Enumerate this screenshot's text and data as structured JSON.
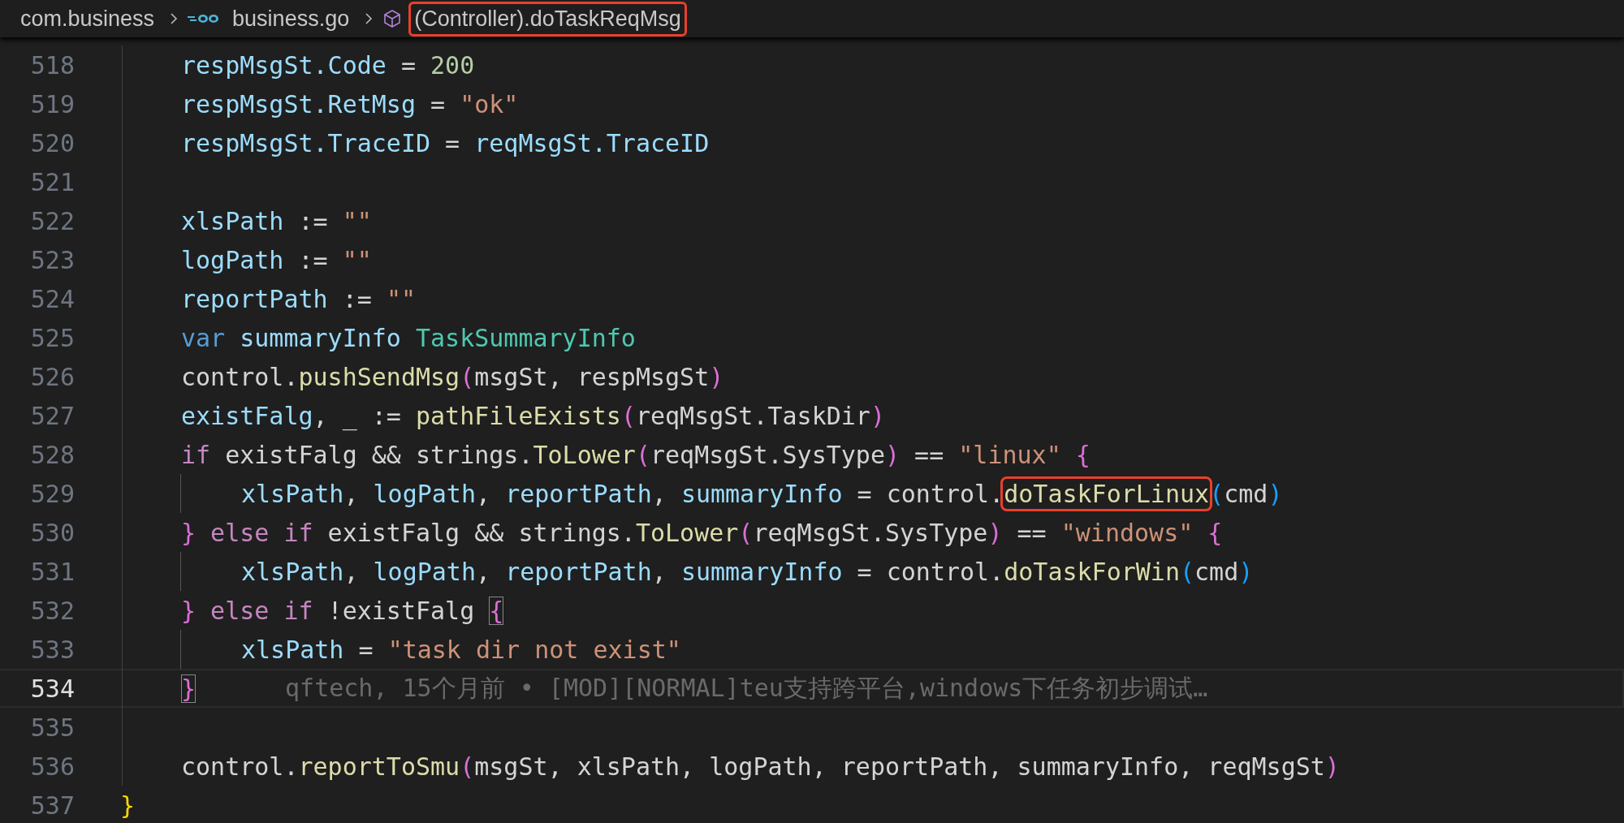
{
  "breadcrumb": [
    {
      "kind": "folder",
      "label": "com.business",
      "highlighted": false
    },
    {
      "kind": "file",
      "label": "business.go",
      "highlighted": false
    },
    {
      "kind": "symbol",
      "label": "(Controller).doTaskReqMsg",
      "highlighted": true
    }
  ],
  "body": [
    {
      "number": "518",
      "tokens": [
        {
          "kind": "var",
          "text": "respMsgSt.Code"
        },
        {
          "kind": "plain",
          "text": " = "
        },
        {
          "kind": "num",
          "text": "200"
        }
      ]
    },
    {
      "number": "519",
      "tokens": [
        {
          "kind": "var",
          "text": "respMsgSt.RetMsg"
        },
        {
          "kind": "plain",
          "text": " = "
        },
        {
          "kind": "str",
          "text": "\"ok\""
        }
      ]
    },
    {
      "number": "520",
      "tokens": [
        {
          "kind": "var",
          "text": "respMsgSt.TraceID"
        },
        {
          "kind": "plain",
          "text": " = "
        },
        {
          "kind": "var",
          "text": "reqMsgSt.TraceID"
        }
      ]
    },
    {
      "number": "521"
    },
    {
      "number": "522",
      "tokens": [
        {
          "kind": "var",
          "text": "xlsPath"
        },
        {
          "kind": "plain",
          "text": " := "
        },
        {
          "kind": "str",
          "text": "\"\""
        }
      ]
    },
    {
      "number": "523",
      "tokens": [
        {
          "kind": "var",
          "text": "logPath"
        },
        {
          "kind": "plain",
          "text": " := "
        },
        {
          "kind": "str",
          "text": "\"\""
        }
      ]
    },
    {
      "number": "524",
      "tokens": [
        {
          "kind": "var",
          "text": "reportPath"
        },
        {
          "kind": "plain",
          "text": " := "
        },
        {
          "kind": "str",
          "text": "\"\""
        }
      ]
    },
    {
      "number": "525",
      "tokens": [
        {
          "kind": "decl",
          "text": "var"
        },
        {
          "kind": "var",
          "text": " summaryInfo"
        },
        {
          "kind": "type",
          "text": " TaskSummaryInfo"
        }
      ]
    },
    {
      "number": "526",
      "tokens": [
        {
          "kind": "plain",
          "text": "control."
        },
        {
          "kind": "fn",
          "text": "pushSendMsg"
        },
        {
          "kind": "b2",
          "text": "("
        },
        {
          "kind": "plain",
          "text": "msgSt, respMsgSt"
        },
        {
          "kind": "b2",
          "text": ")"
        }
      ]
    },
    {
      "number": "527",
      "tokens": [
        {
          "kind": "var",
          "text": "existFalg"
        },
        {
          "kind": "plain",
          "text": ", _ := "
        },
        {
          "kind": "fn",
          "text": "pathFileExists"
        },
        {
          "kind": "b2",
          "text": "("
        },
        {
          "kind": "plain",
          "text": "reqMsgSt.TaskDir"
        },
        {
          "kind": "b2",
          "text": ")"
        }
      ]
    },
    {
      "number": "528",
      "tokens": [
        {
          "kind": "kw",
          "text": "if"
        },
        {
          "kind": "plain",
          "text": " existFalg && strings."
        },
        {
          "kind": "fn",
          "text": "ToLower"
        },
        {
          "kind": "b2",
          "text": "("
        },
        {
          "kind": "plain",
          "text": "reqMsgSt.SysType"
        },
        {
          "kind": "b2",
          "text": ")"
        },
        {
          "kind": "plain",
          "text": " == "
        },
        {
          "kind": "str",
          "text": "\"linux\""
        },
        {
          "kind": "b2",
          "text": " {"
        }
      ],
      "children": [
        {
          "number": "529",
          "tokens": [
            {
              "kind": "var",
              "text": "xlsPath"
            },
            {
              "kind": "plain",
              "text": ", "
            },
            {
              "kind": "var",
              "text": "logPath"
            },
            {
              "kind": "plain",
              "text": ", "
            },
            {
              "kind": "var",
              "text": "reportPath"
            },
            {
              "kind": "plain",
              "text": ", "
            },
            {
              "kind": "var",
              "text": "summaryInfo"
            },
            {
              "kind": "plain",
              "text": " = control."
            },
            {
              "kind": "fn",
              "text": "doTaskForLinux",
              "highlighted": true
            },
            {
              "kind": "b3",
              "text": "("
            },
            {
              "kind": "plain",
              "text": "cmd"
            },
            {
              "kind": "b3",
              "text": ")"
            }
          ]
        }
      ]
    },
    {
      "number": "530",
      "tokens": [
        {
          "kind": "b2",
          "text": "}"
        },
        {
          "kind": "kw",
          "text": " else if"
        },
        {
          "kind": "plain",
          "text": " existFalg && strings."
        },
        {
          "kind": "fn",
          "text": "ToLower"
        },
        {
          "kind": "b2",
          "text": "("
        },
        {
          "kind": "plain",
          "text": "reqMsgSt.SysType"
        },
        {
          "kind": "b2",
          "text": ")"
        },
        {
          "kind": "plain",
          "text": " == "
        },
        {
          "kind": "str",
          "text": "\"windows\""
        },
        {
          "kind": "b2",
          "text": " {"
        }
      ],
      "children": [
        {
          "number": "531",
          "tokens": [
            {
              "kind": "var",
              "text": "xlsPath"
            },
            {
              "kind": "plain",
              "text": ", "
            },
            {
              "kind": "var",
              "text": "logPath"
            },
            {
              "kind": "plain",
              "text": ", "
            },
            {
              "kind": "var",
              "text": "reportPath"
            },
            {
              "kind": "plain",
              "text": ", "
            },
            {
              "kind": "var",
              "text": "summaryInfo"
            },
            {
              "kind": "plain",
              "text": " = control."
            },
            {
              "kind": "fn",
              "text": "doTaskForWin"
            },
            {
              "kind": "b3",
              "text": "("
            },
            {
              "kind": "plain",
              "text": "cmd"
            },
            {
              "kind": "b3",
              "text": ")"
            }
          ]
        }
      ]
    },
    {
      "number": "532",
      "tokens": [
        {
          "kind": "b2",
          "text": "}"
        },
        {
          "kind": "kw",
          "text": " else if"
        },
        {
          "kind": "plain",
          "text": " !existFalg "
        },
        {
          "kind": "b2",
          "text": "{",
          "matched": true
        }
      ],
      "children": [
        {
          "number": "533",
          "tokens": [
            {
              "kind": "var",
              "text": "xlsPath"
            },
            {
              "kind": "plain",
              "text": " = "
            },
            {
              "kind": "str",
              "text": "\"task dir not exist\""
            }
          ]
        }
      ]
    },
    {
      "number": "534",
      "current": true,
      "tokens": [
        {
          "kind": "b2",
          "text": "}",
          "matched": true
        }
      ],
      "blame": "qftech, 15个月前 • [MOD][NORMAL]teu支持跨平台,windows下任务初步调试…"
    },
    {
      "number": "535"
    },
    {
      "number": "536",
      "tokens": [
        {
          "kind": "plain",
          "text": "control."
        },
        {
          "kind": "fn",
          "text": "reportToSmu"
        },
        {
          "kind": "b2",
          "text": "("
        },
        {
          "kind": "plain",
          "text": "msgSt, xlsPath, logPath, reportPath, summaryInfo, reqMsgSt"
        },
        {
          "kind": "b2",
          "text": ")"
        }
      ]
    }
  ],
  "end_line": {
    "number": "537",
    "tokens": [
      {
        "kind": "b1",
        "text": "}"
      }
    ]
  }
}
